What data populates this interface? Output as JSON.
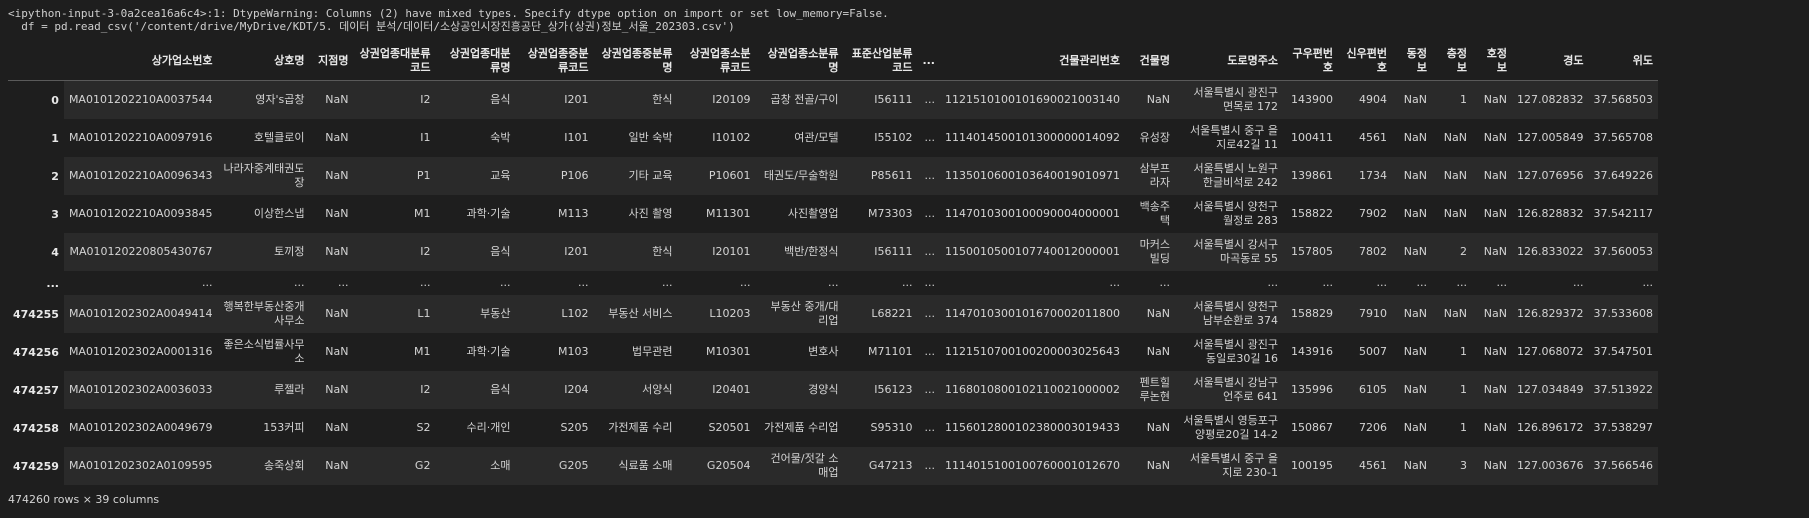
{
  "warning": {
    "line1": "<ipython-input-3-0a2cea16a6c4>:1: DtypeWarning: Columns (2) have mixed types. Specify dtype option on import or set low_memory=False.",
    "line2": "  df = pd.read_csv('/content/drive/MyDrive/KDT/5. 데이터 분석/데이터/소상공인시장진흥공단_상가(상권)정보_서울_202303.csv')"
  },
  "table": {
    "columns": [
      "상가업소번호",
      "상호명",
      "지점명",
      "상권업종대분류코드",
      "상권업종대분류명",
      "상권업종중분류코드",
      "상권업종중분류명",
      "상권업종소분류코드",
      "상권업종소분류명",
      "표준산업분류코드",
      "...",
      "건물관리번호",
      "건물명",
      "도로명주소",
      "구우편번호",
      "신우편번호",
      "동정보",
      "층정보",
      "호정보",
      "경도",
      "위도"
    ],
    "rows": [
      {
        "index": "0",
        "cells": [
          "MA0101202210A0037544",
          "영자's곱창",
          "NaN",
          "I2",
          "음식",
          "I201",
          "한식",
          "I20109",
          "곱창 전골/구이",
          "I56111",
          "...",
          "1121510100101690021003140",
          "NaN",
          "서울특별시 광진구 면목로 172",
          "143900",
          "4904",
          "NaN",
          "1",
          "NaN",
          "127.082832",
          "37.568503"
        ]
      },
      {
        "index": "1",
        "cells": [
          "MA0101202210A0097916",
          "호텔클로이",
          "NaN",
          "I1",
          "숙박",
          "I101",
          "일반 숙박",
          "I10102",
          "여관/모텔",
          "I55102",
          "...",
          "1114014500101300000014092",
          "유성장",
          "서울특별시 중구 을지로42길 11",
          "100411",
          "4561",
          "NaN",
          "NaN",
          "NaN",
          "127.005849",
          "37.565708"
        ]
      },
      {
        "index": "2",
        "cells": [
          "MA0101202210A0096343",
          "나라자중계태권도장",
          "NaN",
          "P1",
          "교육",
          "P106",
          "기타 교육",
          "P10601",
          "태권도/무술학원",
          "P85611",
          "...",
          "1135010600103640019010971",
          "삼부프라자",
          "서울특별시 노원구 한글비석로 242",
          "139861",
          "1734",
          "NaN",
          "NaN",
          "NaN",
          "127.076956",
          "37.649226"
        ]
      },
      {
        "index": "3",
        "cells": [
          "MA0101202210A0093845",
          "이상한스냅",
          "NaN",
          "M1",
          "과학·기술",
          "M113",
          "사진 촬영",
          "M11301",
          "사진촬영업",
          "M73303",
          "...",
          "1147010300100090004000001",
          "백송주택",
          "서울특별시 양천구 월정로 283",
          "158822",
          "7902",
          "NaN",
          "NaN",
          "NaN",
          "126.828832",
          "37.542117"
        ]
      },
      {
        "index": "4",
        "cells": [
          "MA010120220805430767",
          "토끼정",
          "NaN",
          "I2",
          "음식",
          "I201",
          "한식",
          "I20101",
          "백반/한정식",
          "I56111",
          "...",
          "1150010500107740012000001",
          "마커스빌딩",
          "서울특별시 강서구 마곡동로 55",
          "157805",
          "7802",
          "NaN",
          "2",
          "NaN",
          "126.833022",
          "37.560053"
        ]
      },
      {
        "index": "...",
        "ellipsis": true,
        "cells": [
          "...",
          "...",
          "...",
          "...",
          "...",
          "...",
          "...",
          "...",
          "...",
          "...",
          "...",
          "...",
          "...",
          "...",
          "...",
          "...",
          "...",
          "...",
          "...",
          "...",
          "..."
        ]
      },
      {
        "index": "474255",
        "cells": [
          "MA0101202302A0049414",
          "행복한부동산중개사무소",
          "NaN",
          "L1",
          "부동산",
          "L102",
          "부동산 서비스",
          "L10203",
          "부동산 중개/대리업",
          "L68221",
          "...",
          "1147010300101670002011800",
          "NaN",
          "서울특별시 양천구 남부순환로 374",
          "158829",
          "7910",
          "NaN",
          "NaN",
          "NaN",
          "126.829372",
          "37.533608"
        ]
      },
      {
        "index": "474256",
        "cells": [
          "MA0101202302A0001316",
          "좋은소식법률사무소",
          "NaN",
          "M1",
          "과학·기술",
          "M103",
          "법무관련",
          "M10301",
          "변호사",
          "M71101",
          "...",
          "1121510700100200003025643",
          "NaN",
          "서울특별시 광진구 동일로30길 16",
          "143916",
          "5007",
          "NaN",
          "1",
          "NaN",
          "127.068072",
          "37.547501"
        ]
      },
      {
        "index": "474257",
        "cells": [
          "MA0101202302A0036033",
          "루젤라",
          "NaN",
          "I2",
          "음식",
          "I204",
          "서양식",
          "I20401",
          "경양식",
          "I56123",
          "...",
          "1168010800102110021000002",
          "펜트힐루논현",
          "서울특별시 강남구 언주로 641",
          "135996",
          "6105",
          "NaN",
          "1",
          "NaN",
          "127.034849",
          "37.513922"
        ]
      },
      {
        "index": "474258",
        "cells": [
          "MA0101202302A0049679",
          "153커피",
          "NaN",
          "S2",
          "수리·개인",
          "S205",
          "가전제품 수리",
          "S20501",
          "가전제품 수리업",
          "S95310",
          "...",
          "1156012800102380003019433",
          "NaN",
          "서울특별시 영등포구 양평로20길 14-2",
          "150867",
          "7206",
          "NaN",
          "1",
          "NaN",
          "126.896172",
          "37.538297"
        ]
      },
      {
        "index": "474259",
        "cells": [
          "MA0101202302A0109595",
          "송죽상회",
          "NaN",
          "G2",
          "소매",
          "G205",
          "식료품 소매",
          "G20504",
          "건어물/젓갈 소매업",
          "G47213",
          "...",
          "1114015100100760001012670",
          "NaN",
          "서울특별시 중구 을지로 230-1",
          "100195",
          "4561",
          "NaN",
          "3",
          "NaN",
          "127.003676",
          "37.566546"
        ]
      }
    ]
  },
  "footer": "474260 rows × 39 columns"
}
